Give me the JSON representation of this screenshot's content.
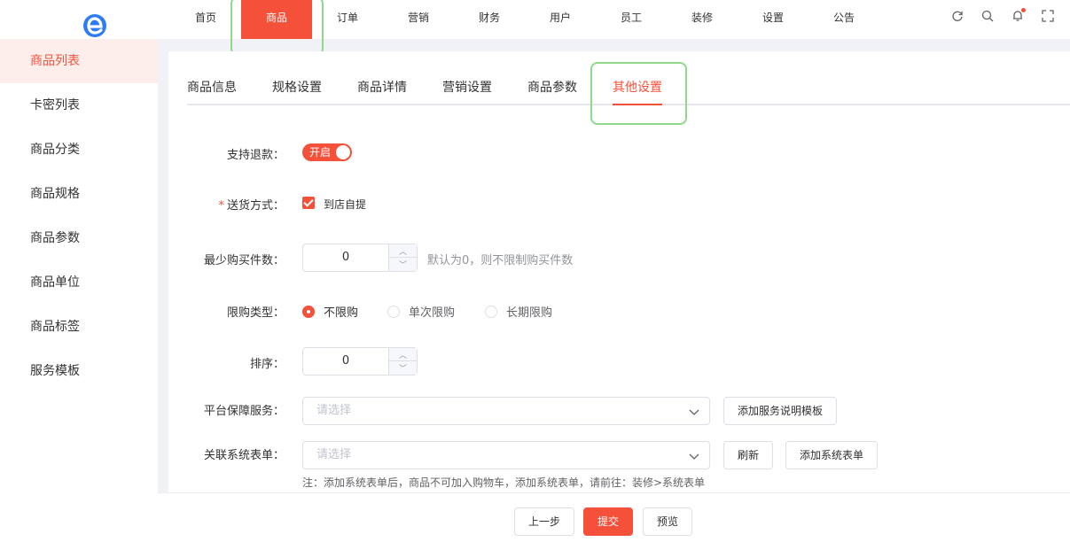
{
  "header": {
    "nav": [
      {
        "label": "首页"
      },
      {
        "label": "商品"
      },
      {
        "label": "订单"
      },
      {
        "label": "营销"
      },
      {
        "label": "财务"
      },
      {
        "label": "用户"
      },
      {
        "label": "员工"
      },
      {
        "label": "装修"
      },
      {
        "label": "设置"
      },
      {
        "label": "公告"
      }
    ],
    "active_nav": "商品",
    "tools": [
      "refresh-icon",
      "search-icon",
      "bell-icon",
      "fullscreen-icon"
    ]
  },
  "sidebar": {
    "items": [
      {
        "label": "商品列表"
      },
      {
        "label": "卡密列表"
      },
      {
        "label": "商品分类"
      },
      {
        "label": "商品规格"
      },
      {
        "label": "商品参数"
      },
      {
        "label": "商品单位"
      },
      {
        "label": "商品标签"
      },
      {
        "label": "服务模板"
      }
    ]
  },
  "tabs": [
    {
      "label": "商品信息"
    },
    {
      "label": "规格设置"
    },
    {
      "label": "商品详情"
    },
    {
      "label": "营销设置"
    },
    {
      "label": "商品参数"
    },
    {
      "label": "其他设置"
    }
  ],
  "form": {
    "refund": {
      "label": "支持退款：",
      "switch_text": "开启",
      "on": true
    },
    "delivery": {
      "label": "送货方式：",
      "option": "到店自提",
      "checked": true
    },
    "min_purchase": {
      "label": "最少购买件数：",
      "value": "0",
      "hint": "默认为0，则不限制购买件数"
    },
    "limit_type": {
      "label": "限购类型：",
      "options": [
        "不限购",
        "单次限购",
        "长期限购"
      ],
      "selected": "不限购"
    },
    "sort": {
      "label": "排序：",
      "value": "0"
    },
    "guarantee": {
      "label": "平台保障服务：",
      "placeholder": "请选择",
      "button": "添加服务说明模板"
    },
    "system_form": {
      "label": "关联系统表单：",
      "placeholder": "请选择",
      "refresh_button": "刷新",
      "add_button": "添加系统表单",
      "note": "注：添加系统表单后，商品不可加入购物车，添加系统表单，请前往：装修>系统表单"
    }
  },
  "footer": {
    "prev": "上一步",
    "submit": "提交",
    "preview": "预览"
  },
  "colors": {
    "accent": "#f5503a",
    "highlight": "#8fd98a"
  }
}
